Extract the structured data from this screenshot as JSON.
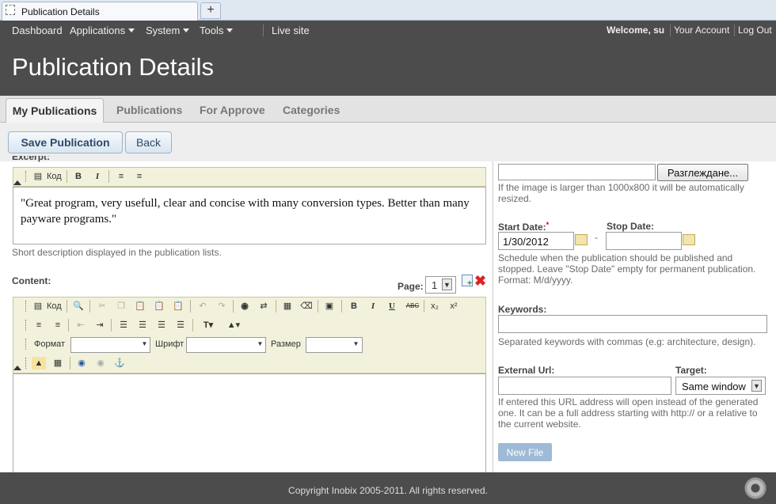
{
  "browser": {
    "tab_title": "Publication Details",
    "new_tab": "+"
  },
  "topnav": {
    "items": [
      "Dashboard",
      "Applications",
      "System",
      "Tools"
    ],
    "live_site": "Live site",
    "welcome": "Welcome, su",
    "account": "Your Account",
    "logout": "Log Out"
  },
  "page": {
    "title": "Publication Details"
  },
  "tabs": [
    "My Publications",
    "Publications",
    "For Approve",
    "Categories"
  ],
  "actions": {
    "save": "Save Publication",
    "back": "Back"
  },
  "excerpt": {
    "label": "Excerpt:",
    "toolbar_code": "Код",
    "text": "\"Great program, very usefull, clear and concise with many conversion types. Better than many payware programs.\"",
    "hint": "Short description displayed in the publication lists."
  },
  "content": {
    "label": "Content:",
    "page_label": "Page:",
    "page_value": "1",
    "toolbar_code": "Код",
    "format_label": "Формат",
    "font_label": "Шрифт",
    "size_label": "Размер"
  },
  "image": {
    "browse_button": "Разглеждане...",
    "hint": "If the image is larger than 1000x800 it will be automatically resized."
  },
  "schedule": {
    "start_label": "Start Date:",
    "start_value": "1/30/2012",
    "dash": "-",
    "stop_label": "Stop Date:",
    "stop_value": "",
    "hint": "Schedule when the publication should be published and stopped. Leave \"Stop Date\" empty for permanent publication. Format: M/d/yyyy."
  },
  "keywords": {
    "label": "Keywords:",
    "value": "",
    "hint": "Separated keywords with commas (e.g: architecture, design)."
  },
  "external": {
    "label": "External Url:",
    "value": "",
    "target_label": "Target:",
    "target_value": "Same window",
    "hint": "If entered this URL address will open instead of the generated one. It can be a full address starting with http:// or a relative to the current website."
  },
  "new_file": "New File",
  "footer": {
    "copyright": "Copyright Inobix 2005-2011. All rights reserved."
  },
  "colors": {
    "topbar": "#4c4c4c",
    "toolbar": "#f2f2dc",
    "button_text": "#2c4a6b"
  }
}
